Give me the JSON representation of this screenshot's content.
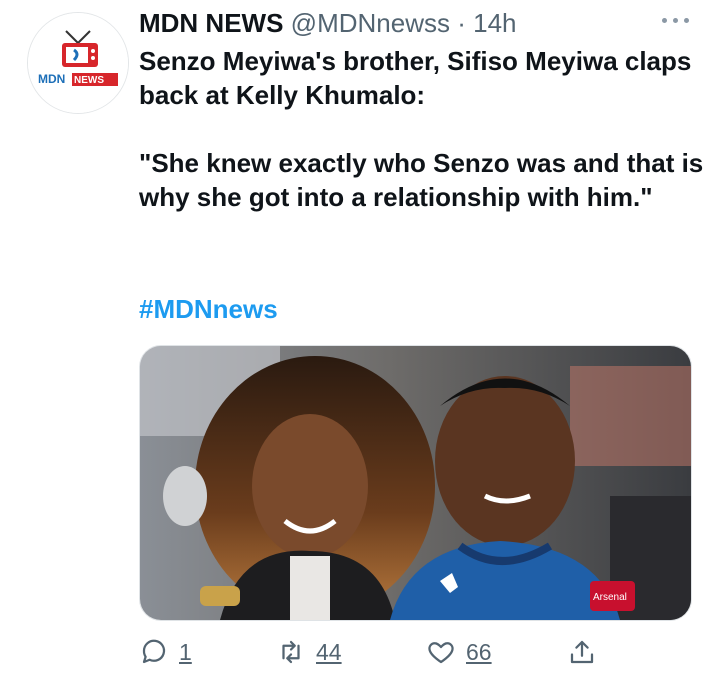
{
  "tweet": {
    "author_name": "MDN NEWS",
    "handle": "@MDNnewss",
    "separator": "·",
    "time": "14h",
    "avatar_logo_text": "MDN NEWS",
    "text_line1": "Senzo Meyiwa's brother, Sifiso Meyiwa claps back at Kelly Khumalo:",
    "quote": "\"She knew exactly who Senzo was and that is why she got into a relationship with him.\"",
    "hashtag": "#MDNnews",
    "image_jersey_text": "Arsenal"
  },
  "actions": {
    "reply_count": "1",
    "retweet_count": "44",
    "like_count": "66"
  },
  "colors": {
    "link": "#1d9bf0",
    "muted": "#536471",
    "text": "#0f1419",
    "logo_red": "#d7262b"
  },
  "icons": {
    "more": "more-dots-icon",
    "reply": "reply-bubble-icon",
    "retweet": "retweet-arrows-icon",
    "like": "heart-icon",
    "share": "share-upload-icon"
  }
}
